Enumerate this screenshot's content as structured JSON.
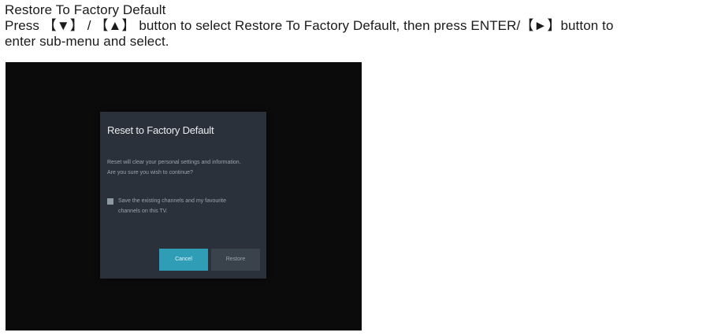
{
  "doc": {
    "heading": "Restore To Factory Default",
    "line1": "Press 【▼】 / 【▲】 button to select Restore To Factory Default, then press ENTER/【►】button to",
    "line2": "enter sub-menu and select."
  },
  "dialog": {
    "title": "Reset to Factory Default",
    "message_line1": "Reset will clear your personal settings and information.",
    "message_line2": "Are you sure you wish to continue?",
    "option_line1": "Save the existing channels and my favourite",
    "option_line2": "channels on this TV.",
    "option_checked": false,
    "cancel_label": "Cancel",
    "restore_label": "Restore",
    "focused_button": "Cancel"
  },
  "colors": {
    "screen_bg": "#0b0b0b",
    "dialog_bg": "#2a313a",
    "accent": "#2f9db5"
  }
}
